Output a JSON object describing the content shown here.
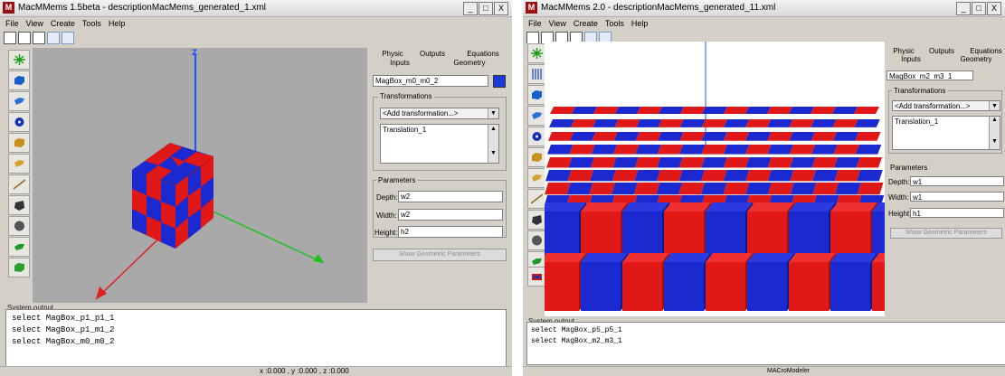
{
  "window1": {
    "title": "MacMMems 1.5beta - descriptionMacMems_generated_1.xml",
    "app_icon_letter": "M",
    "controls": [
      "_",
      "□",
      "X"
    ],
    "menu": [
      "File",
      "View",
      "Create",
      "Tools",
      "Help"
    ],
    "axis_label": "z",
    "tabs_top": [
      "Physic",
      "Outputs",
      "Equations"
    ],
    "tabs_bottom": [
      "Inputs",
      "Geometry"
    ],
    "object_name": "MagBox_m0_m0_2",
    "object_color": "#1a3ad6",
    "transformations_label": "Transformations",
    "add_transformation": "<Add transformation...>",
    "transformation_items": [
      "Translation_1"
    ],
    "parameters_label": "Parameters",
    "params": [
      {
        "label": "Depth:",
        "value": "w2"
      },
      {
        "label": "Width:",
        "value": "w2"
      },
      {
        "label": "Height:",
        "value": "h2"
      }
    ],
    "show_params_button": "Show Geometric Parameters",
    "system_output_label": "System output",
    "output_lines": [
      "select MagBox_p1_p1_1",
      "select MagBox_p1_m1_2",
      "select MagBox_m0_m0_2"
    ],
    "status": "x :0.000 , y :0.000 , z :0.000"
  },
  "window2": {
    "title": "MacMMems 2.0 - descriptionMacMems_generated_11.xml",
    "app_icon_letter": "M",
    "controls": [
      "_",
      "□",
      "X"
    ],
    "menu": [
      "File",
      "View",
      "Create",
      "Tools",
      "Help"
    ],
    "tabs_top": [
      "Physic",
      "Outputs",
      "Equations"
    ],
    "tabs_bottom": [
      "Inputs",
      "Geometry"
    ],
    "object_name": "MagBox_m2_m3_1",
    "object_color": "#1a3ad6",
    "transformations_label": "Transformations",
    "add_transformation": "<Add transformation...>",
    "transformation_items": [
      "Translation_1"
    ],
    "parameters_label": "Parameters",
    "params": [
      {
        "label": "Depth:",
        "value": "w1"
      },
      {
        "label": "Width:",
        "value": "w1"
      },
      {
        "label": "Height:",
        "value": "h1"
      }
    ],
    "show_params_button": "Show Geometric Parameters",
    "system_output_label": "System output",
    "output_lines": [
      "select MagBox_p5_p5_1",
      "select MagBox_m2_m3_1"
    ],
    "status": "MACroModeler"
  },
  "colors": {
    "cube_red": "#e01818",
    "cube_blue": "#1a2ad0",
    "axis_blue": "#2050ff",
    "axis_green": "#20c020",
    "axis_red": "#e02020"
  },
  "tool_icons": [
    "axes-tool-icon",
    "box-tool-icon",
    "slab-tool-icon",
    "torus-tool-icon",
    "gold-box-tool-icon",
    "gold-slab-tool-icon",
    "line-tool-icon",
    "cone-tool-icon",
    "sphere-tool-icon",
    "green-slab-tool-icon",
    "green-box-tool-icon",
    "magnet-tool-icon"
  ]
}
